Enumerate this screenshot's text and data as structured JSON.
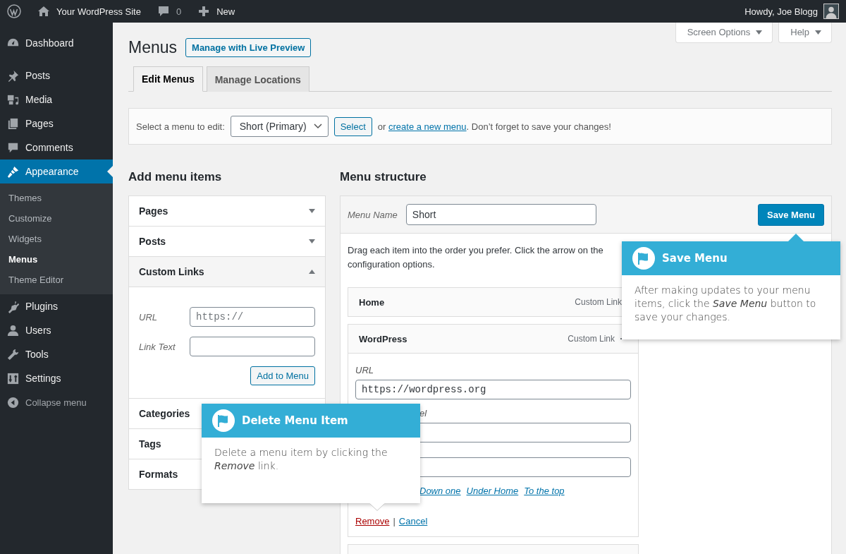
{
  "admin_bar": {
    "site_name": "Your WordPress Site",
    "comments_count": "0",
    "new_label": "New",
    "greeting": "Howdy, Joe Blogg"
  },
  "sidebar": {
    "items": [
      {
        "label": "Dashboard",
        "kind": "dashboard",
        "selected": false
      },
      {
        "label": "Posts",
        "kind": "pin",
        "selected": false
      },
      {
        "label": "Media",
        "kind": "media",
        "selected": false
      },
      {
        "label": "Pages",
        "kind": "pages",
        "selected": false
      },
      {
        "label": "Comments",
        "kind": "comment",
        "selected": false
      },
      {
        "label": "Appearance",
        "kind": "brush",
        "selected": true,
        "children": [
          {
            "label": "Themes",
            "selected": false
          },
          {
            "label": "Customize",
            "selected": false
          },
          {
            "label": "Widgets",
            "selected": false
          },
          {
            "label": "Menus",
            "selected": true
          },
          {
            "label": "Theme Editor",
            "selected": false
          }
        ]
      },
      {
        "label": "Plugins",
        "kind": "plug",
        "selected": false
      },
      {
        "label": "Users",
        "kind": "user",
        "selected": false
      },
      {
        "label": "Tools",
        "kind": "wrench",
        "selected": false
      },
      {
        "label": "Settings",
        "kind": "settings",
        "selected": false
      },
      {
        "label": "Collapse menu",
        "kind": "collapse",
        "selected": false
      }
    ]
  },
  "screen_meta": [
    "Screen Options",
    "Help"
  ],
  "page": {
    "title": "Menus",
    "action_button": "Manage with Live Preview"
  },
  "tabs": [
    {
      "label": "Edit Menus",
      "selected": true
    },
    {
      "label": "Manage Locations",
      "selected": false
    }
  ],
  "select_bar": {
    "label": "Select a menu to edit:",
    "dropdown_value": "Short (Primary)",
    "button": "Select",
    "text_before_link": "or",
    "link": "create a new menu",
    "text_after_link": ". Don’t forget to save your changes!"
  },
  "add_items": {
    "heading": "Add menu items",
    "sections": [
      {
        "title": "Pages",
        "expanded": false
      },
      {
        "title": "Posts",
        "expanded": false
      },
      {
        "title": "Custom Links",
        "expanded": true,
        "fields": [
          {
            "label": "URL",
            "placeholder": "https://"
          },
          {
            "label": "Link Text"
          }
        ],
        "button": "Add to Menu"
      },
      {
        "title": "Categories"
      },
      {
        "title": "Tags"
      },
      {
        "title": "Formats"
      }
    ]
  },
  "menu_structure": {
    "heading": "Menu structure",
    "name_label": "Menu Name",
    "name_value": "Short",
    "save_button": "Save Menu",
    "instructions": [
      "Drag each item into the order you prefer. Click the arrow on the",
      "configuration options."
    ],
    "items": [
      {
        "title": "Home",
        "type": "Custom Link"
      },
      {
        "title": "WordPress",
        "type": "Custom Link",
        "expanded": true,
        "settings": {
          "url_label": "URL",
          "url_value": "https://wordpress.org",
          "label_fragment": "el",
          "move_links": [
            "Down one",
            "Under Home",
            "To the top"
          ],
          "remove": "Remove",
          "separator": "|",
          "cancel": "Cancel"
        }
      }
    ]
  },
  "tooltips": [
    {
      "title": "Save Menu",
      "body": "After making updates to your menu items, click the *Save Menu* button to save your changes."
    },
    {
      "title": "Delete Menu Item",
      "body": "Delete a menu item by clicking the *Remove* link."
    }
  ]
}
